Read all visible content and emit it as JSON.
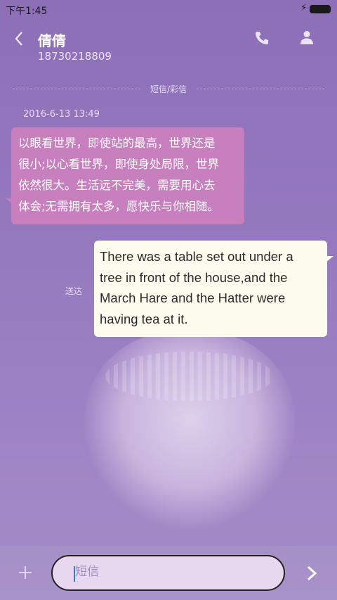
{
  "status_bar": {
    "time": "下午1:45"
  },
  "header": {
    "contact_name": "倩倩",
    "contact_number": "18730218809"
  },
  "divider": {
    "label": "短信/彩信"
  },
  "messages": [
    {
      "direction": "incoming",
      "timestamp": "2016-6-13 13:49",
      "lines": [
        "以眼看世界，即使站的最高，世界还是",
        "很小;以心看世界，即使身处局限，世界",
        "依然很大。生活远不完美，需要用心去",
        "体会;无需拥有太多，愿快乐与你相随。"
      ]
    },
    {
      "direction": "outgoing",
      "status": "送达",
      "lines": [
        "There was a table set out under a",
        "tree in front of the house,and the",
        "March Hare and the Hatter were",
        "having tea at it."
      ]
    }
  ],
  "composer": {
    "placeholder": "短信",
    "value": ""
  },
  "icons": {
    "back": "back-arrow-icon",
    "call": "phone-icon",
    "contact": "person-icon",
    "attach": "plus-icon",
    "send": "send-arrow-icon"
  },
  "colors": {
    "incoming_bubble": "#c77fbe",
    "outgoing_bubble": "#fdfbee",
    "background": "#9579bf"
  }
}
